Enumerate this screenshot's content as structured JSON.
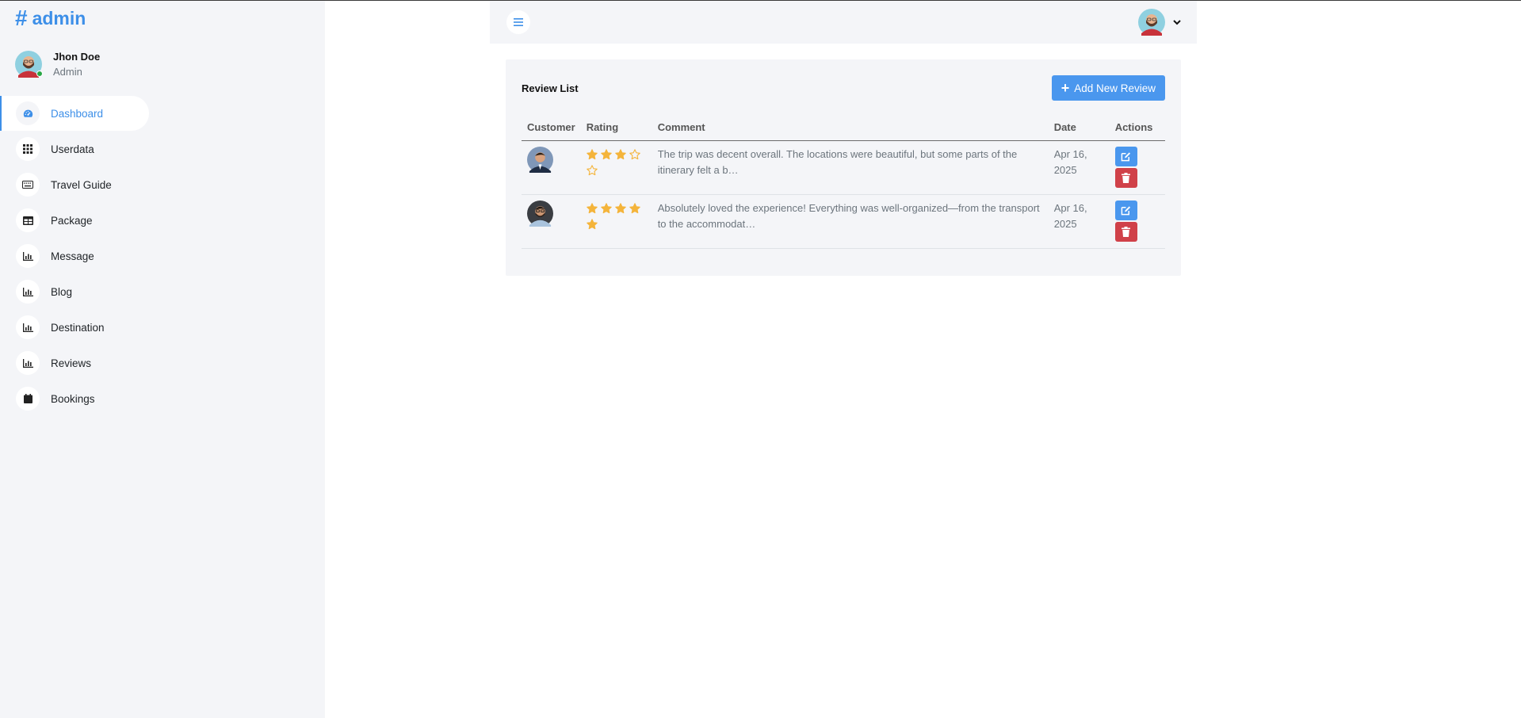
{
  "brand": {
    "symbol": "#",
    "name": "admin"
  },
  "profile": {
    "name": "Jhon Doe",
    "role": "Admin"
  },
  "nav": [
    {
      "label": "Dashboard",
      "icon": "gauge-icon",
      "active": true
    },
    {
      "label": "Userdata",
      "icon": "grid-icon",
      "active": false
    },
    {
      "label": "Travel Guide",
      "icon": "keyboard-icon",
      "active": false
    },
    {
      "label": "Package",
      "icon": "table-icon",
      "active": false
    },
    {
      "label": "Message",
      "icon": "chart-icon",
      "active": false
    },
    {
      "label": "Blog",
      "icon": "chart-icon",
      "active": false
    },
    {
      "label": "Destination",
      "icon": "chart-icon",
      "active": false
    },
    {
      "label": "Reviews",
      "icon": "chart-icon",
      "active": false
    },
    {
      "label": "Bookings",
      "icon": "calendar-icon",
      "active": false
    }
  ],
  "topbar": {
    "menu_icon": "hamburger-icon",
    "dropdown_icon": "chevron-down-icon"
  },
  "reviews": {
    "title": "Review List",
    "add_button": "Add New Review",
    "columns": [
      "Customer",
      "Rating",
      "Comment",
      "Date",
      "Actions"
    ],
    "rows": [
      {
        "rating": 3,
        "max_rating": 5,
        "comment": "The trip was decent overall. The locations were beautiful, but some parts of the itinerary felt a b…",
        "date": "Apr 16, 2025"
      },
      {
        "rating": 5,
        "max_rating": 5,
        "comment": "Absolutely loved the experience! Everything was well-organized—from the transport to the accommodat…",
        "date": "Apr 16, 2025"
      }
    ]
  },
  "colors": {
    "accent": "#3d8fe8",
    "button_primary": "#4a97ee",
    "button_danger": "#d04149",
    "star": "#f4b43b",
    "panel": "#f4f5f8"
  }
}
